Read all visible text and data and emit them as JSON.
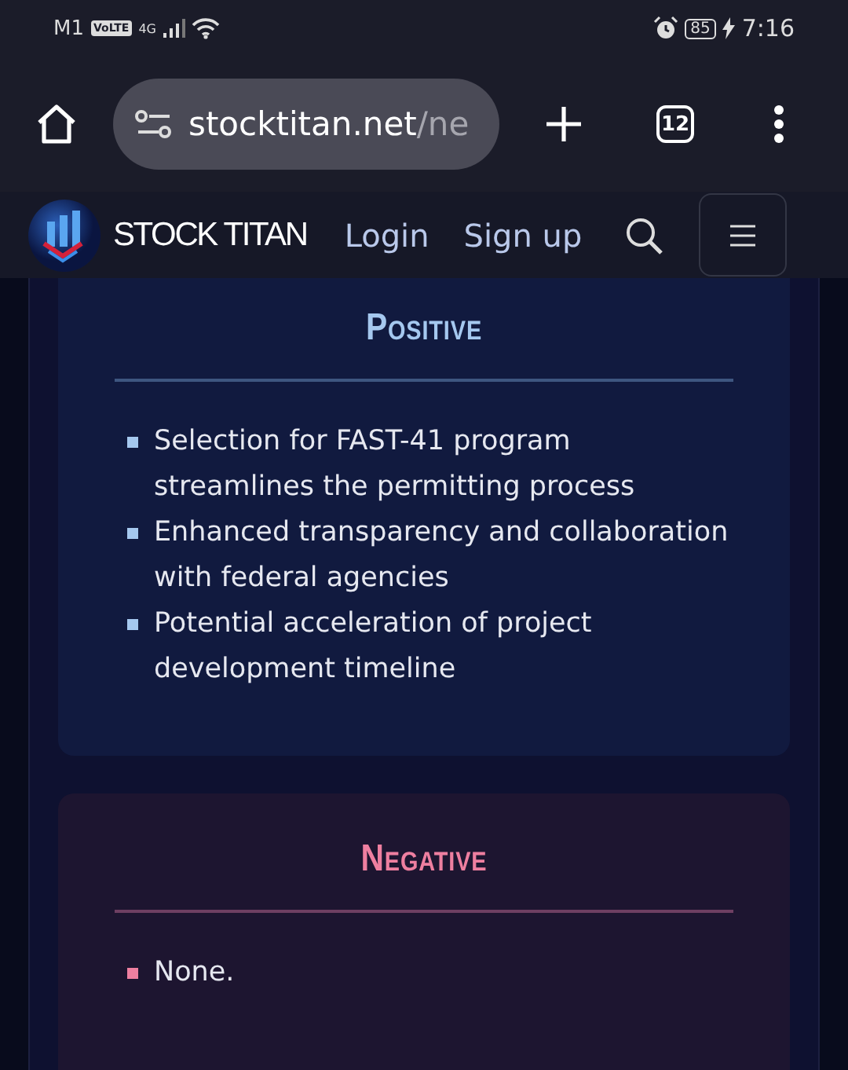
{
  "status_bar": {
    "carrier": "M1",
    "volte": "VoLTE",
    "network": "4G",
    "battery": "85",
    "time": "7:16"
  },
  "browser": {
    "url_host": "stocktitan.net",
    "url_rest": "/ne",
    "tab_count": "12"
  },
  "site_header": {
    "brand": "STOCK TITAN",
    "links": [
      "Login",
      "Sign up"
    ]
  },
  "sections": [
    {
      "kind": "positive",
      "title": "Positive",
      "items": [
        "Selection for FAST-41 program streamlines the permitting process",
        "Enhanced transparency and collaboration with federal agencies",
        "Potential acceleration of project development timeline"
      ]
    },
    {
      "kind": "negative",
      "title": "Negative",
      "items": [
        "None."
      ]
    }
  ]
}
